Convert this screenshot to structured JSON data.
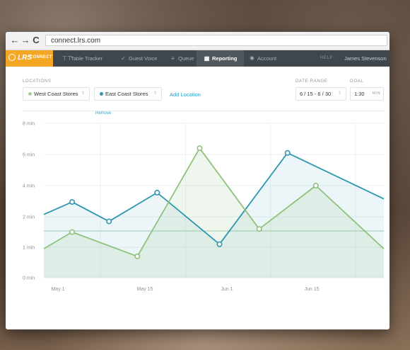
{
  "browser": {
    "back_icon": "arrow-left-icon",
    "forward_icon": "arrow-right-icon",
    "reload_icon": "reload-icon",
    "back_glyph": "←",
    "forward_glyph": "→",
    "reload_glyph": "C",
    "url": "connect.lrs.com"
  },
  "app": {
    "logo_text": "LRS",
    "logo_subtext": "CONNECT",
    "brand_color": "#f5a623",
    "nav": [
      {
        "label": "Table Tracker",
        "icon": "table-icon",
        "glyph": "⊤⊤",
        "active": false
      },
      {
        "label": "Guest Voice",
        "icon": "checkmark-icon",
        "glyph": "✓",
        "active": false
      },
      {
        "label": "Queue",
        "icon": "list-icon",
        "glyph": "≡",
        "active": false
      },
      {
        "label": "Reporting",
        "icon": "building-icon",
        "glyph": "▦",
        "active": true
      },
      {
        "label": "Account",
        "icon": "gear-icon",
        "glyph": "✺",
        "active": false
      }
    ],
    "help_label": "HELP",
    "user_name": "James Stevenson"
  },
  "filters": {
    "locations_label": "LOCATIONS",
    "location_1": "West Coast Stores",
    "location_1_color": "#a7cf94",
    "location_2": "East Coast Stores",
    "location_2_color": "#2e96b1",
    "remove_label": "Remove",
    "add_location_label": "Add Location",
    "date_range_label": "DATE RANGE",
    "date_range_value": "6 / 15 - 6 / 30",
    "goal_label": "GOAL",
    "goal_value": "1:30",
    "goal_unit": "MIN"
  },
  "chart_data": {
    "type": "area",
    "title": "",
    "xlabel": "",
    "ylabel": "",
    "y_ticks": [
      "8 min",
      "6 min",
      "4 min",
      "2 min",
      "1 min",
      "0 min"
    ],
    "x_ticks": [
      "May 1",
      "May 15",
      "Jun 1",
      "Jun 15"
    ],
    "grid": true,
    "goal_line": true,
    "series": [
      {
        "color": "#2e96b1",
        "points": [
          {
            "x": 0.0,
            "y": 2.15
          },
          {
            "x": 0.5,
            "y": 2.95
          },
          {
            "x": 1.15,
            "y": 1.85
          },
          {
            "x": 2.0,
            "y": 3.55
          },
          {
            "x": 3.1,
            "y": 1.1
          },
          {
            "x": 4.3,
            "y": 6.1
          },
          {
            "x": 6.0,
            "y": 3.15
          }
        ]
      },
      {
        "color": "#8ec27c",
        "points": [
          {
            "x": 0.0,
            "y": 0.95
          },
          {
            "x": 0.5,
            "y": 1.5
          },
          {
            "x": 1.65,
            "y": 0.7
          },
          {
            "x": 2.75,
            "y": 6.4
          },
          {
            "x": 3.8,
            "y": 1.6
          },
          {
            "x": 4.8,
            "y": 4.0
          },
          {
            "x": 6.0,
            "y": 0.95
          }
        ]
      }
    ]
  }
}
